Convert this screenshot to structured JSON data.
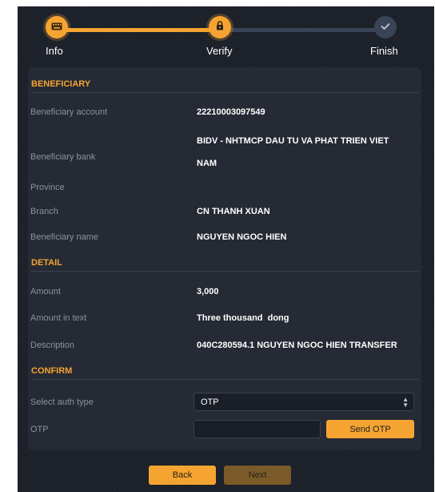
{
  "stepper": {
    "steps": [
      {
        "label": "Info",
        "icon": "keyboard-icon",
        "state": "done"
      },
      {
        "label": "Verify",
        "icon": "lock-icon",
        "state": "active"
      },
      {
        "label": "Finish",
        "icon": "check-icon",
        "state": "pending"
      }
    ]
  },
  "beneficiary": {
    "heading": "BENEFICIARY",
    "account_label": "Beneficiary account",
    "account_value": "22210003097549",
    "bank_label": "Beneficiary bank",
    "bank_value_line1": "BIDV - NHTMCP DAU TU VA PHAT TRIEN VIET",
    "bank_value_line2": "NAM",
    "province_label": "Province",
    "province_value": "",
    "branch_label": "Branch",
    "branch_value": "CN THANH XUAN",
    "name_label": "Beneficiary name",
    "name_value": "NGUYEN NGOC HIEN"
  },
  "detail": {
    "heading": "DETAIL",
    "amount_label": "Amount",
    "amount_value": "3,000",
    "amount_text_label": "Amount in text",
    "amount_text_value": "Three thousand  dong",
    "description_label": "Description",
    "description_value": "040C280594.1 NGUYEN NGOC HIEN TRANSFER"
  },
  "confirm": {
    "heading": "CONFIRM",
    "auth_type_label": "Select auth type",
    "auth_type_value": "OTP",
    "otp_label": "OTP",
    "otp_value": "",
    "send_otp_label": "Send OTP"
  },
  "footer": {
    "back_label": "Back",
    "next_label": "Next"
  },
  "colors": {
    "accent": "#f6a431",
    "background": "#1c2028",
    "panel": "#252a34"
  }
}
